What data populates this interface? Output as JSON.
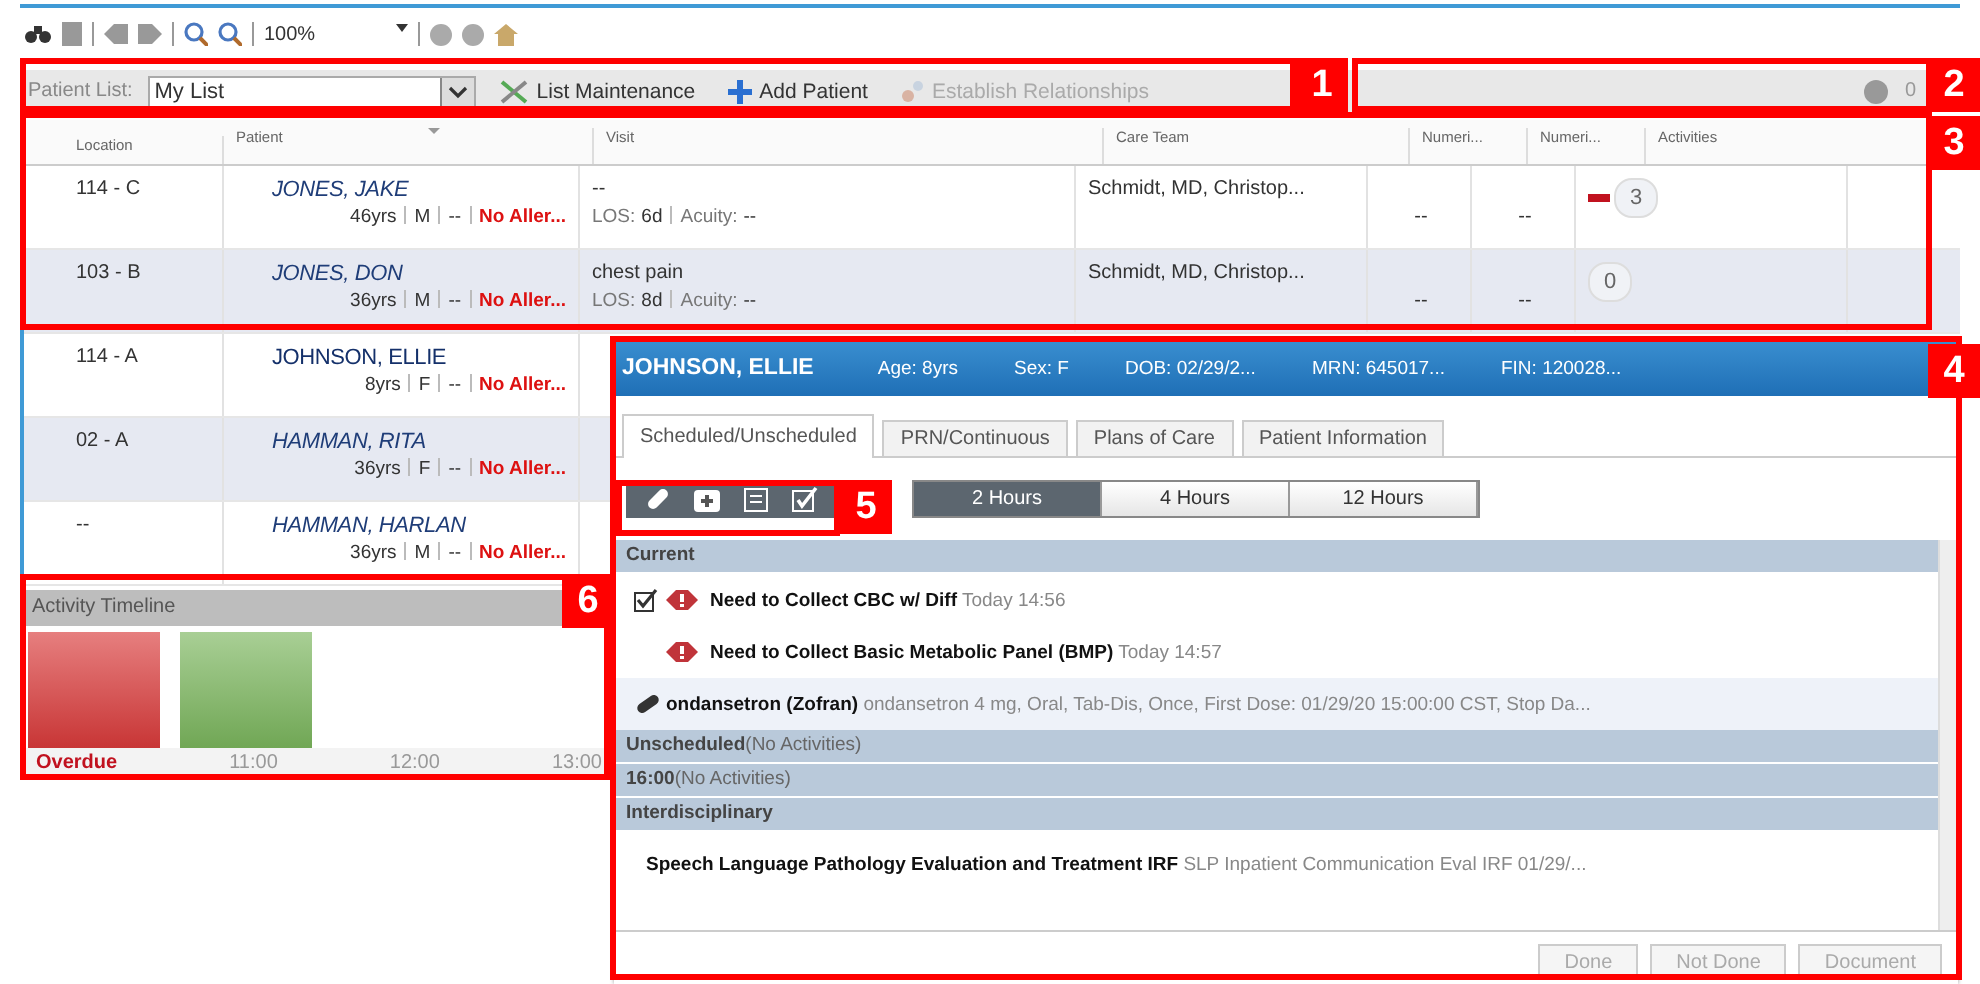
{
  "toolbar": {
    "zoom": "100%"
  },
  "patient_list_bar": {
    "label": "Patient List:",
    "value": "My List",
    "buttons": [
      {
        "label": "List Maintenance",
        "kind": "tools",
        "disabled": false
      },
      {
        "label": "Add Patient",
        "kind": "add",
        "disabled": false
      },
      {
        "label": "Establish Relationships",
        "kind": "relate",
        "disabled": true
      }
    ],
    "count": "0"
  },
  "table": {
    "columns": [
      "Location",
      "Patient",
      "Visit",
      "Care Team",
      "Numeri...",
      "Numeri...",
      "Activities"
    ],
    "rows": [
      {
        "location": "114 - C",
        "name": "JONES, JAKE",
        "selected": false,
        "age": "46yrs",
        "sex": "M",
        "code": "--",
        "allergy": "No Aller...",
        "visit": "--",
        "los_label": "LOS:",
        "los": "6d",
        "acuity_label": "Acuity:",
        "acuity": "--",
        "care_team": "Schmidt, MD, Christop...",
        "num1": "--",
        "num2": "--",
        "activities": "3",
        "overdue": true
      },
      {
        "location": "103 - B",
        "name": "JONES, DON",
        "selected": false,
        "age": "36yrs",
        "sex": "M",
        "code": "--",
        "allergy": "No Aller...",
        "visit": "chest pain",
        "los_label": "LOS:",
        "los": "8d",
        "acuity_label": "Acuity:",
        "acuity": "--",
        "care_team": "Schmidt, MD, Christop...",
        "num1": "--",
        "num2": "--",
        "activities": "0",
        "overdue": false
      },
      {
        "location": "114 - A",
        "name": "JOHNSON, ELLIE",
        "selected": true,
        "age": "8yrs",
        "sex": "F",
        "code": "--",
        "allergy": "No Aller..."
      },
      {
        "location": "02 - A",
        "name": "HAMMAN, RITA",
        "selected": false,
        "age": "36yrs",
        "sex": "F",
        "code": "--",
        "allergy": "No Aller..."
      },
      {
        "location": "--",
        "name": "HAMMAN, HARLAN",
        "selected": false,
        "age": "36yrs",
        "sex": "M",
        "code": "--",
        "allergy": "No Aller..."
      }
    ]
  },
  "activity_timeline": {
    "title": "Activity Timeline",
    "blocks": [
      {
        "color": "#d93a3a"
      },
      {
        "color": "#7ab55c"
      }
    ],
    "labels": [
      {
        "text": "Overdue",
        "kind": "overdue"
      },
      {
        "text": "11:00",
        "kind": "time"
      },
      {
        "text": "12:00",
        "kind": "time"
      },
      {
        "text": "13:00",
        "kind": "time"
      }
    ]
  },
  "patient_panel": {
    "name": "JOHNSON, ELLIE",
    "facts": [
      "Age: 8yrs",
      "Sex: F",
      "DOB: 02/29/2...",
      "MRN: 645017...",
      "FIN: 120028..."
    ],
    "tabs": [
      {
        "label": "Scheduled/Unscheduled",
        "selected": true
      },
      {
        "label": "PRN/Continuous",
        "selected": false
      },
      {
        "label": "Plans of Care",
        "selected": false
      },
      {
        "label": "Patient Information",
        "selected": false
      }
    ],
    "filters": [
      {
        "kind": "pill"
      },
      {
        "kind": "kit"
      },
      {
        "kind": "clipboard"
      },
      {
        "kind": "check"
      }
    ],
    "ranges": [
      {
        "label": "2 Hours",
        "selected": true
      },
      {
        "label": "4 Hours",
        "selected": false
      },
      {
        "label": "12 Hours",
        "selected": false
      }
    ],
    "sections": [
      {
        "title": "Current",
        "items": [
          {
            "kind": "lab",
            "checked": true,
            "name": "Need to Collect CBC w/ Diff",
            "detail": "Today 14:56"
          },
          {
            "kind": "lab",
            "checked": false,
            "name": "Need to Collect Basic Metabolic Panel (BMP)",
            "detail": "Today 14:57"
          },
          {
            "kind": "med",
            "checked": false,
            "name": "ondansetron (Zofran)",
            "detail": "ondansetron 4 mg, Oral, Tab-Dis, Once, First Dose: 01/29/20 15:00:00 CST, Stop Da..."
          }
        ]
      },
      {
        "title": "Unscheduled",
        "note": "(No Activities)"
      },
      {
        "title": "16:00",
        "note": "(No Activities)"
      },
      {
        "title": "Interdisciplinary",
        "items": [
          {
            "kind": "order",
            "checked": false,
            "name": "Speech Language Pathology Evaluation and Treatment IRF",
            "detail": "SLP Inpatient Communication Eval IRF 01/29/..."
          }
        ]
      }
    ],
    "actions": [
      "Done",
      "Not Done",
      "Document"
    ]
  },
  "callouts": [
    "1",
    "2",
    "3",
    "4",
    "5",
    "6"
  ]
}
